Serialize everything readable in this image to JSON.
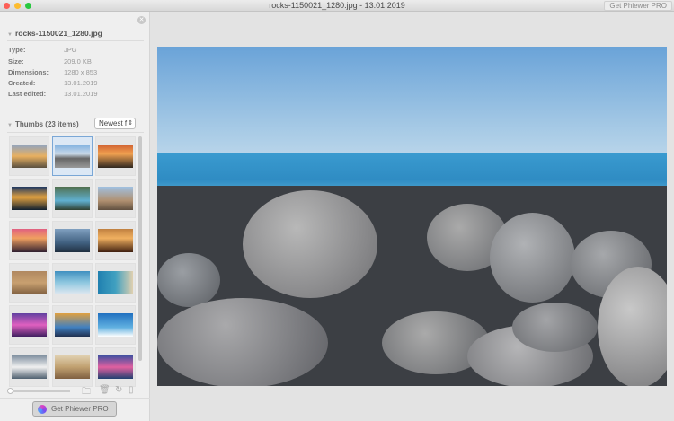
{
  "window": {
    "title": "rocks-1150021_1280.jpg - 13.01.2019",
    "pro_label": "Get Phiewer PRO"
  },
  "info": {
    "filename": "rocks-1150021_1280.jpg",
    "rows": [
      {
        "label": "Type:",
        "value": "JPG"
      },
      {
        "label": "Size:",
        "value": "209.0 KB"
      },
      {
        "label": "Dimensions:",
        "value": "1280 x 853"
      },
      {
        "label": "Created:",
        "value": "13.01.2019"
      },
      {
        "label": "Last edited:",
        "value": "13.01.2019"
      }
    ]
  },
  "thumbs": {
    "header": "Thumbs (23 items)",
    "sort": "Newest f",
    "selected_index": 1
  },
  "footer": {
    "pro_button": "Get Phiewer PRO"
  },
  "colors": {
    "selected": "#7aa7d6"
  }
}
